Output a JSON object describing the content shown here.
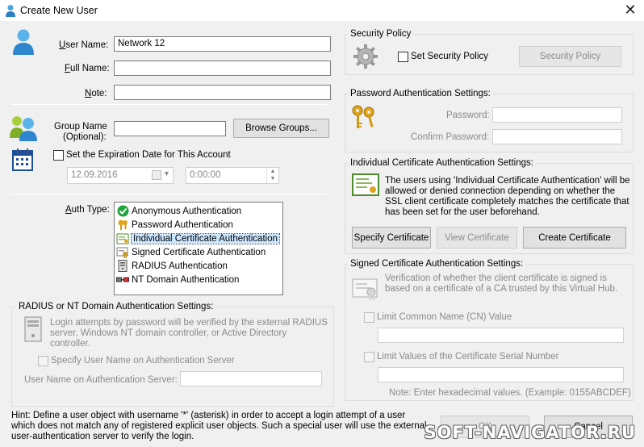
{
  "window": {
    "title": "Create New User",
    "close_glyph": "✕"
  },
  "user": {
    "user_name_label": "User Name:",
    "user_name_value": "Network 12",
    "full_name_label": "Full Name:",
    "full_name_value": "",
    "note_label": "Note:",
    "note_value": "",
    "group_name_label_1": "Group Name",
    "group_name_label_2": "(Optional):",
    "group_name_value": "",
    "browse_groups_label": "Browse Groups...",
    "expiration_label": "Set the Expiration Date for This Account",
    "expiration_date": "12.09.2016",
    "expiration_time": "0:00:00"
  },
  "auth": {
    "auth_type_label": "Auth Type:",
    "types": [
      {
        "label": "Anonymous Authentication",
        "icon": "check-icon"
      },
      {
        "label": "Password Authentication",
        "icon": "keys-icon"
      },
      {
        "label": "Individual Certificate Authentication",
        "icon": "certificate-icon"
      },
      {
        "label": "Signed Certificate Authentication",
        "icon": "signed-certificate-icon"
      },
      {
        "label": "RADIUS Authentication",
        "icon": "server-icon"
      },
      {
        "label": "NT Domain Authentication",
        "icon": "network-icon"
      }
    ],
    "selected_index": 2
  },
  "radius": {
    "group_title": "RADIUS or NT Domain Authentication Settings:",
    "description": "Login attempts by password will be verified by the external RADIUS server, Windows NT domain controller, or Active Directory controller.",
    "specify_label": "Specify User Name on Authentication Server",
    "username_label": "User Name on Authentication Server:",
    "username_value": ""
  },
  "security_policy": {
    "group_title": "Security Policy",
    "checkbox_label": "Set Security Policy",
    "button_label": "Security Policy"
  },
  "password_settings": {
    "group_title": "Password Authentication Settings:",
    "password_label": "Password:",
    "confirm_label": "Confirm Password:"
  },
  "individual_cert": {
    "group_title": "Individual Certificate Authentication Settings:",
    "description": "The users using 'Individual Certificate Authentication' will be allowed or denied connection depending on whether the SSL client certificate completely matches the certificate that has been set for the user beforehand.",
    "specify_button": "Specify Certificate",
    "view_button": "View Certificate",
    "create_button": "Create Certificate"
  },
  "signed_cert": {
    "group_title": "Signed Certificate Authentication Settings:",
    "description": "Verification of whether the client certificate is signed is based on a certificate of a CA trusted by this Virtual Hub.",
    "limit_cn_label": "Limit Common Name (CN) Value",
    "limit_serial_label": "Limit Values of the Certificate Serial Number",
    "note": "Note: Enter hexadecimal values. (Example: 0155ABCDEF)"
  },
  "footer": {
    "hint": "Hint: Define a user object with username '*' (asterisk) in order to accept a login attempt of a user which does not match any of registered explicit user objects. Such a special user will use the external user-authentication server to verify the login.",
    "ok_label": "OK",
    "cancel_label": "Cancel"
  },
  "watermark": "SOFT-NAVIGATOR.RU"
}
